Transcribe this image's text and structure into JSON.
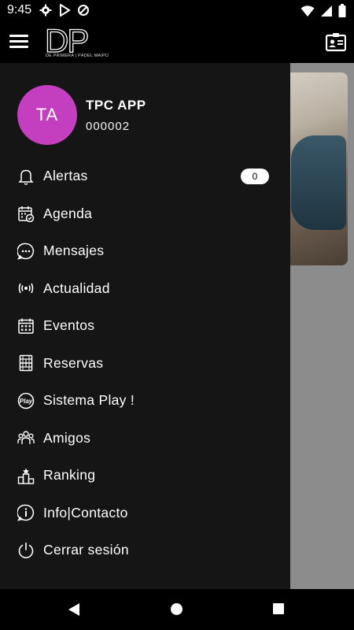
{
  "status_bar": {
    "time": "9:45"
  },
  "app_bar": {
    "logo_text": "DP",
    "logo_subtitle": "DE PRIMERA | PÁDEL MAIPÚ"
  },
  "user": {
    "initials": "TA",
    "name": "TPC APP",
    "id": "000002",
    "avatar_color": "#c43ec0"
  },
  "menu": {
    "items": [
      {
        "label": "Alertas",
        "icon": "bell-icon",
        "badge": "0"
      },
      {
        "label": "Agenda",
        "icon": "calendar-check-icon"
      },
      {
        "label": "Mensajes",
        "icon": "chat-bubble-icon"
      },
      {
        "label": "Actualidad",
        "icon": "broadcast-icon"
      },
      {
        "label": "Eventos",
        "icon": "calendar-grid-icon"
      },
      {
        "label": "Reservas",
        "icon": "court-icon"
      },
      {
        "label": "Sistema Play !",
        "icon": "play-badge-icon"
      },
      {
        "label": "Amigos",
        "icon": "friends-icon"
      },
      {
        "label": "Ranking",
        "icon": "podium-icon"
      },
      {
        "label": "Info|Contacto",
        "icon": "info-icon"
      },
      {
        "label": "Cerrar sesión",
        "icon": "power-icon"
      }
    ]
  },
  "colors": {
    "drawer_bg": "#151515",
    "accent": "#c43ec0"
  }
}
